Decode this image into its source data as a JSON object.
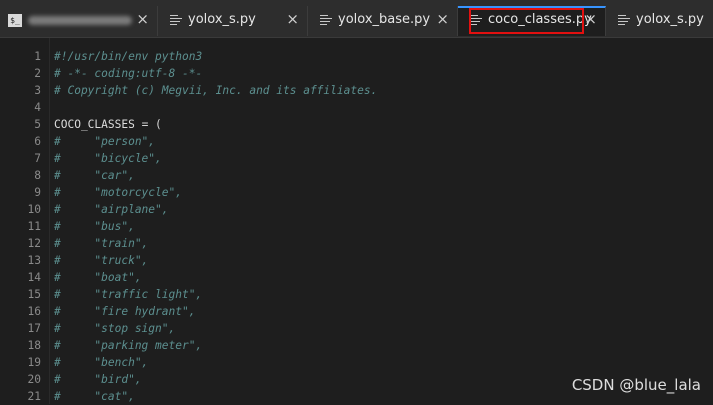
{
  "tabs": [
    {
      "label": "",
      "icon": "terminal-icon",
      "obscured": true
    },
    {
      "label": "yolox_s.py",
      "icon": "file-lines-icon"
    },
    {
      "label": "yolox_base.py",
      "icon": "file-lines-icon"
    },
    {
      "label": "coco_classes.py",
      "icon": "file-lines-icon",
      "active": true
    },
    {
      "label": "yolox_s.py",
      "icon": "file-lines-icon"
    }
  ],
  "close_glyph": "×",
  "terminal_glyph": "$_",
  "colors": {
    "highlight": "#e21010",
    "active_tab_accent": "#3794ff",
    "comment": "#5c8f8f"
  },
  "editor": {
    "lines": [
      {
        "n": "1",
        "text": "#!/usr/bin/env python3",
        "kind": "comment"
      },
      {
        "n": "2",
        "text": "# -*- coding:utf-8 -*-",
        "kind": "comment"
      },
      {
        "n": "3",
        "text": "# Copyright (c) Megvii, Inc. and its affiliates.",
        "kind": "comment"
      },
      {
        "n": "4",
        "text": "",
        "kind": "blank"
      },
      {
        "n": "5",
        "ident": "COCO_CLASSES",
        "op": " = (",
        "kind": "code"
      },
      {
        "n": "6",
        "text": "#     \"person\",",
        "kind": "comment"
      },
      {
        "n": "7",
        "text": "#     \"bicycle\",",
        "kind": "comment"
      },
      {
        "n": "8",
        "text": "#     \"car\",",
        "kind": "comment"
      },
      {
        "n": "9",
        "text": "#     \"motorcycle\",",
        "kind": "comment"
      },
      {
        "n": "10",
        "text": "#     \"airplane\",",
        "kind": "comment"
      },
      {
        "n": "11",
        "text": "#     \"bus\",",
        "kind": "comment"
      },
      {
        "n": "12",
        "text": "#     \"train\",",
        "kind": "comment"
      },
      {
        "n": "13",
        "text": "#     \"truck\",",
        "kind": "comment"
      },
      {
        "n": "14",
        "text": "#     \"boat\",",
        "kind": "comment"
      },
      {
        "n": "15",
        "text": "#     \"traffic light\",",
        "kind": "comment"
      },
      {
        "n": "16",
        "text": "#     \"fire hydrant\",",
        "kind": "comment"
      },
      {
        "n": "17",
        "text": "#     \"stop sign\",",
        "kind": "comment"
      },
      {
        "n": "18",
        "text": "#     \"parking meter\",",
        "kind": "comment"
      },
      {
        "n": "19",
        "text": "#     \"bench\",",
        "kind": "comment"
      },
      {
        "n": "20",
        "text": "#     \"bird\",",
        "kind": "comment"
      },
      {
        "n": "21",
        "text": "#     \"cat\",",
        "kind": "comment"
      }
    ]
  },
  "watermark": "CSDN @blue_lala"
}
